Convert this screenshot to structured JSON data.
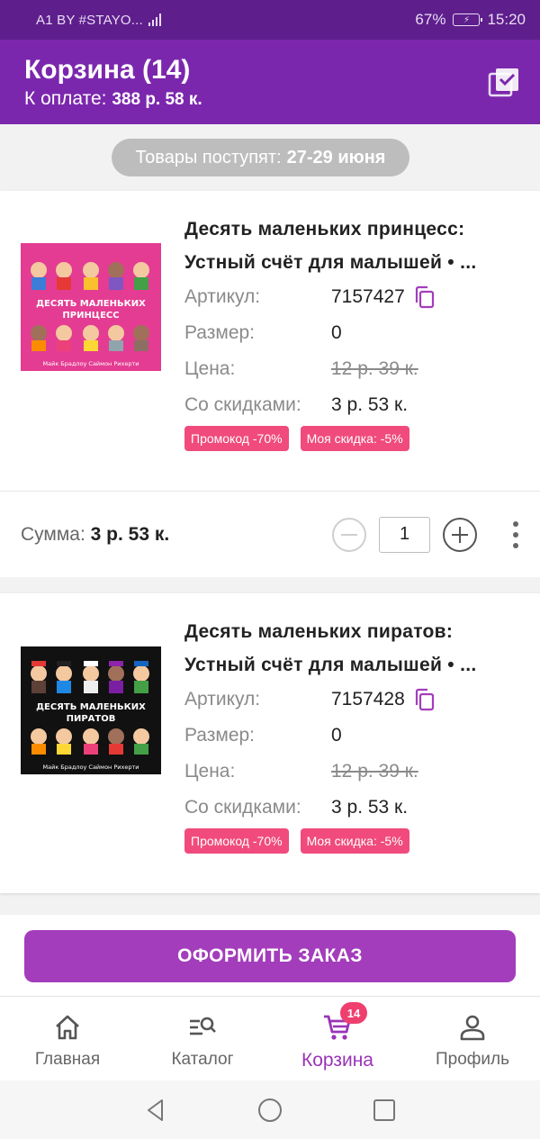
{
  "status_bar": {
    "carrier": "A1 BY #STAYO...",
    "battery_percent": "67%",
    "time": "15:20"
  },
  "header": {
    "title": "Корзина (14)",
    "to_pay_label": "К оплате:",
    "to_pay_value": "388 р. 58 к."
  },
  "delivery": {
    "label": "Товары поступят:",
    "dates": "27-29 июня"
  },
  "labels": {
    "article": "Артикул:",
    "size": "Размер:",
    "price": "Цена:",
    "discounted": "Со скидками:",
    "sum": "Сумма:"
  },
  "items": [
    {
      "title_line1": "Десять маленьких принцесс:",
      "title_line2": "Устный счёт для малышей • ...",
      "article": "7157427",
      "size": "0",
      "old_price": "12 р. 39 к.",
      "discounted_price": "3 р. 53 к.",
      "badges": [
        "Промокод -70%",
        "Моя скидка: -5%"
      ],
      "sum": "3 р. 53 к.",
      "quantity": "1",
      "cover": {
        "bg": "#e43c92",
        "title": "ДЕСЯТЬ МАЛЕНЬКИХ ПРИНЦЕСС",
        "authors": "Майк Брадлоу   Саймон Рихерти"
      }
    },
    {
      "title_line1": "Десять маленьких пиратов:",
      "title_line2": "Устный счёт для малышей • ...",
      "article": "7157428",
      "size": "0",
      "old_price": "12 р. 39 к.",
      "discounted_price": "3 р. 53 к.",
      "badges": [
        "Промокод -70%",
        "Моя скидка: -5%"
      ],
      "cover": {
        "bg": "#111111",
        "title": "ДЕСЯТЬ МАЛЕНЬКИХ ПИРАТОВ",
        "authors": "Майк Брадлоу   Саймон Рихерти"
      }
    }
  ],
  "order_button": "ОФОРМИТЬ ЗАКАЗ",
  "bottom_nav": [
    {
      "label": "Главная",
      "icon": "home-icon"
    },
    {
      "label": "Каталог",
      "icon": "catalog-search-icon"
    },
    {
      "label": "Корзина",
      "icon": "cart-icon",
      "badge": "14",
      "active": true
    },
    {
      "label": "Профиль",
      "icon": "profile-icon"
    }
  ],
  "colors": {
    "accent": "#7b27ad",
    "button": "#a33dbb",
    "badge": "#f04b7c"
  }
}
